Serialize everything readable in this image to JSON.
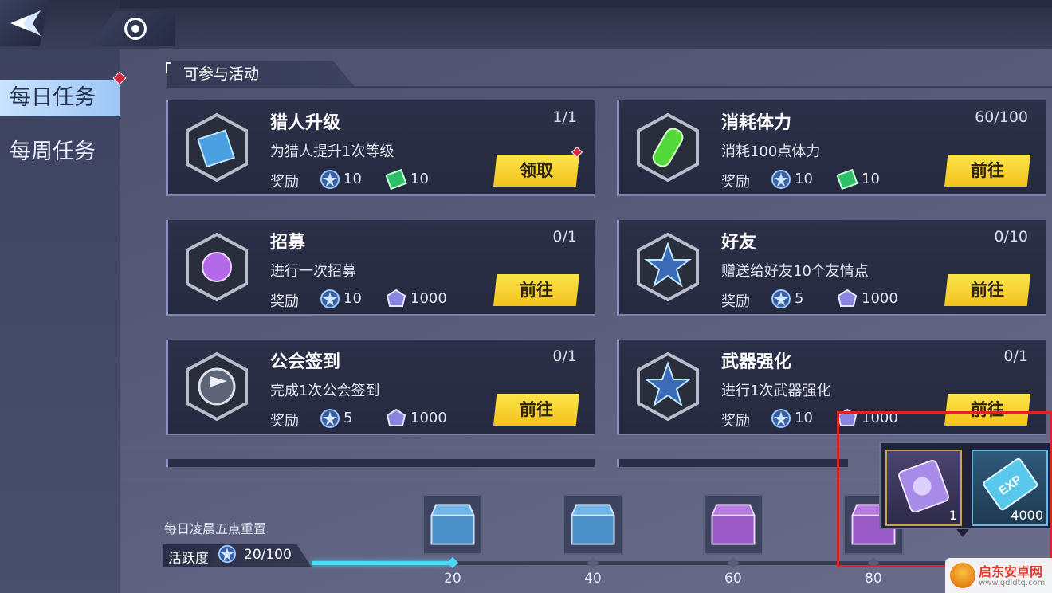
{
  "section_title": "可参与活动",
  "sidebar": {
    "tabs": [
      {
        "label": "每日任务",
        "active": true
      },
      {
        "label": "每周任务",
        "active": false
      }
    ]
  },
  "tasks": [
    {
      "title": "猎人升级",
      "progress": "1/1",
      "desc": "为猎人提升1次等级",
      "reward_label": "奖励",
      "reward1": "10",
      "reward2": "10",
      "action": "领取",
      "reward2_icon": "ticket-icon",
      "icon": "book-icon"
    },
    {
      "title": "消耗体力",
      "progress": "60/100",
      "desc": "消耗100点体力",
      "reward_label": "奖励",
      "reward1": "10",
      "reward2": "10",
      "action": "前往",
      "reward2_icon": "ticket-icon",
      "icon": "potion-icon"
    },
    {
      "title": "招募",
      "progress": "0/1",
      "desc": "进行一次招募",
      "reward_label": "奖励",
      "reward1": "10",
      "reward2": "1000",
      "action": "前往",
      "reward2_icon": "crystal-icon",
      "icon": "puzzle-icon"
    },
    {
      "title": "好友",
      "progress": "0/10",
      "desc": "赠送给好友10个友情点",
      "reward_label": "奖励",
      "reward1": "5",
      "reward2": "1000",
      "action": "前往",
      "reward2_icon": "crystal-icon",
      "icon": "star-badge-icon"
    },
    {
      "title": "公会签到",
      "progress": "0/1",
      "desc": "完成1次公会签到",
      "reward_label": "奖励",
      "reward1": "5",
      "reward2": "1000",
      "action": "前往",
      "reward2_icon": "crystal-icon",
      "icon": "flag-icon"
    },
    {
      "title": "武器强化",
      "progress": "0/1",
      "desc": "进行1次武器强化",
      "reward_label": "奖励",
      "reward1": "10",
      "reward2": "1000",
      "action": "前往",
      "reward2_icon": "crystal-icon",
      "icon": "star-badge-icon"
    }
  ],
  "activity": {
    "reset_text": "每日凌晨五点重置",
    "label": "活跃度",
    "value": "20/100",
    "progress": 0.2,
    "milestones": [
      "20",
      "40",
      "60",
      "80"
    ]
  },
  "popup": {
    "items": [
      {
        "icon": "voucher-icon",
        "qty": "1"
      },
      {
        "icon": "exp-card-icon",
        "qty": "4000",
        "label": "EXP"
      }
    ]
  },
  "watermark": {
    "name": "启东安卓网",
    "url": "www.qdldtq.com"
  },
  "colors": {
    "button_yellow": "#f7d531",
    "accent_cyan": "#4dd8f5",
    "highlight_red": "#e02222",
    "badge_red": "#d8263a"
  }
}
